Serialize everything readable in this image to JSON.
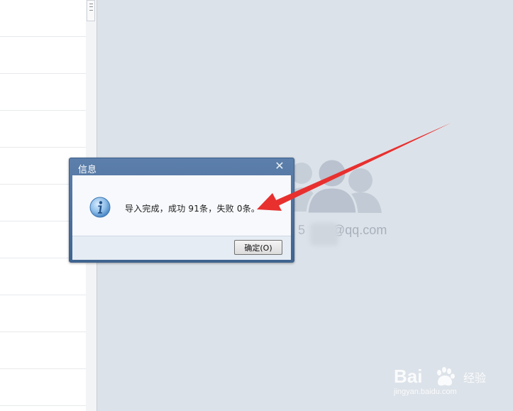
{
  "dialog": {
    "title": "信息",
    "message": "导入完成，成功 91条，失败 0条。",
    "ok_label": "确定(O)"
  },
  "right_panel": {
    "email_partial": "@qq.com"
  },
  "watermark": {
    "brand": "Bai",
    "sub": "经验",
    "url": "jingyan.baidu.com"
  },
  "colors": {
    "dialog_title_bar": "#4d7099",
    "arrow": "#e8302f",
    "panel_bg": "#dce2e9"
  },
  "icons": {
    "info": "info-icon",
    "close": "close-icon",
    "avatars": "user-group-icon"
  }
}
